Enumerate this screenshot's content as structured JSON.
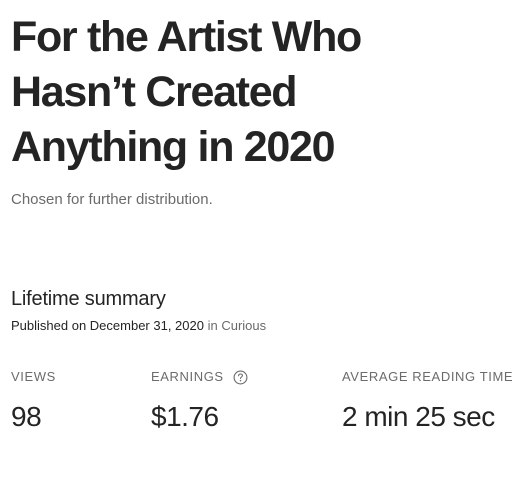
{
  "story": {
    "title": "For the Artist Who\nHasn’t Created\nAnything in 2020",
    "distribution_note": "Chosen for further distribution."
  },
  "summary": {
    "heading": "Lifetime summary",
    "published_prefix": "Published on December 31, 2020",
    "in_word": "in",
    "publication": "Curious"
  },
  "stats": {
    "views": {
      "label": "VIEWS",
      "value": "98"
    },
    "earnings": {
      "label": "EARNINGS",
      "value": "$1.76",
      "help_icon": "question-circle-icon"
    },
    "reading_time": {
      "label": "AVERAGE READING TIME",
      "value": "2 min 25 sec"
    }
  },
  "colors": {
    "text_primary": "#242424",
    "text_secondary": "#6b6b6b",
    "background": "#ffffff"
  }
}
